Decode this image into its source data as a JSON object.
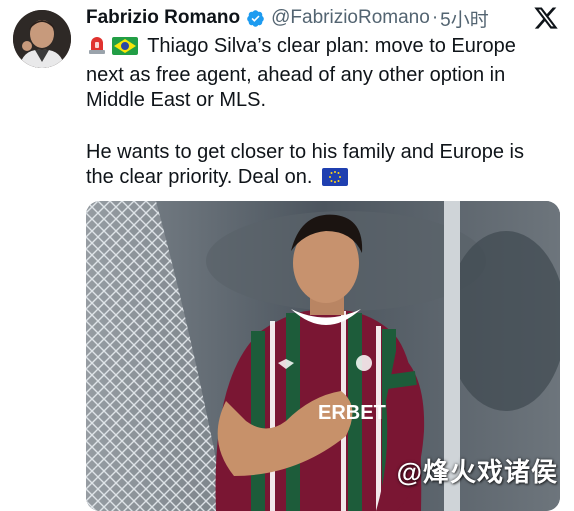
{
  "author": {
    "name": "Fabrizio Romano",
    "handle": "@FabrizioRomano",
    "separator": "·",
    "time": "5小时",
    "verified": true
  },
  "icons": {
    "verified": "verified-badge-icon",
    "platform": "x-logo-icon",
    "siren": "siren-emoji",
    "brazil": "brazil-flag-emoji",
    "eu": "eu-flag-emoji"
  },
  "tweet": {
    "line1": "Thiago Silva’s clear plan: move to Europe next as free agent, ahead of any other option in Middle East or MLS.",
    "line2": "He wants to get closer to his family and Europe is the clear priority. Deal on."
  },
  "media": {
    "shirt_text": "ERBET"
  },
  "watermark": "@烽火戏诸侯",
  "colors": {
    "verified": "#1d9bf0",
    "text": "#0f1419",
    "muted": "#536471",
    "shirt_maroon": "#7a1633",
    "shirt_green": "#1d5c3a"
  }
}
